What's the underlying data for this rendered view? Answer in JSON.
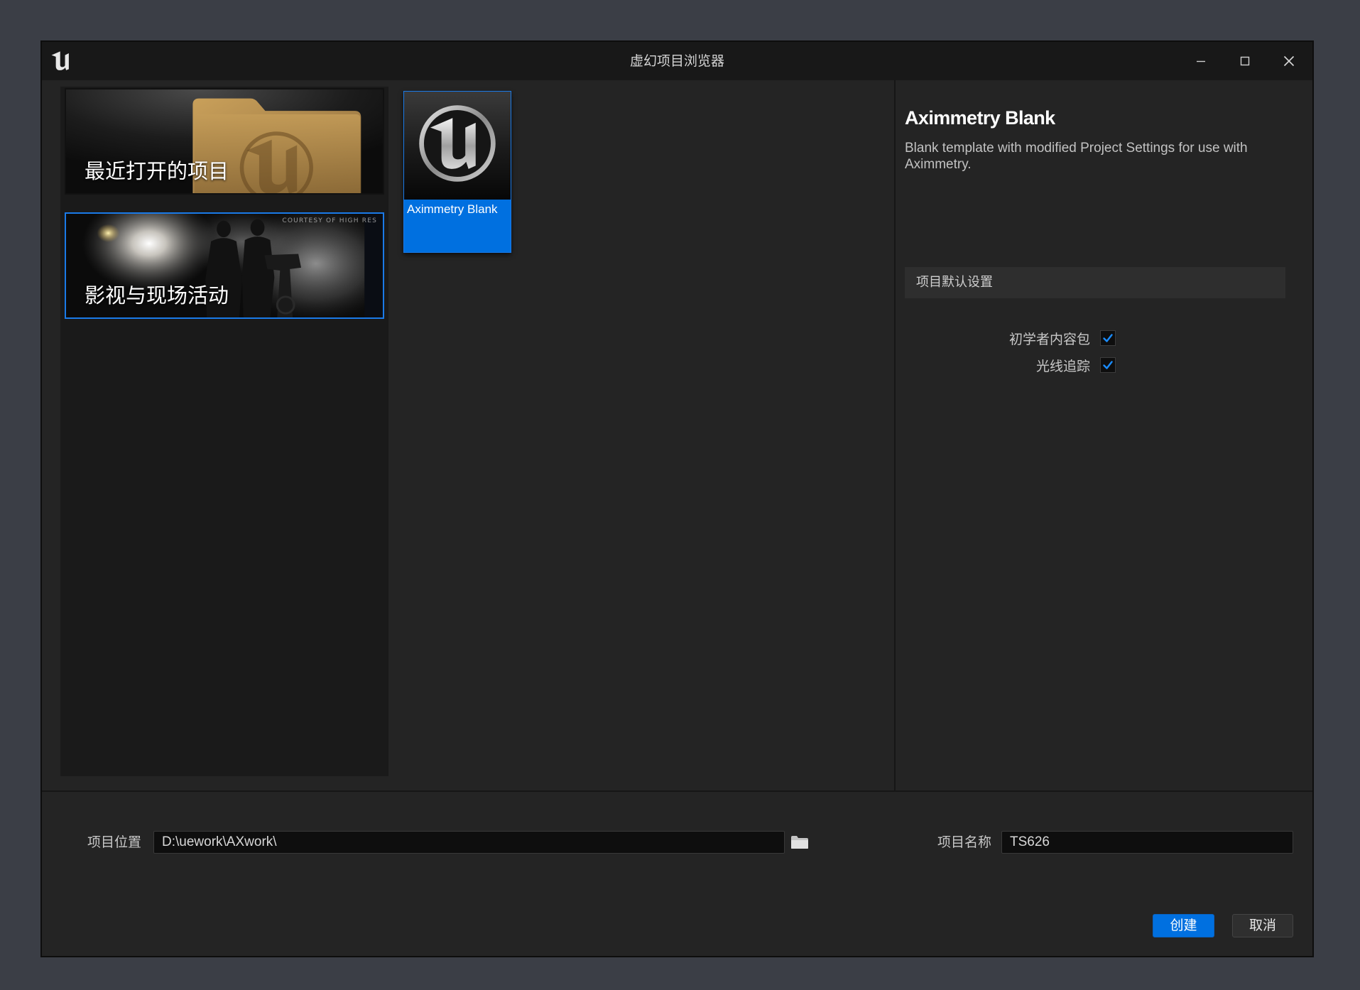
{
  "window": {
    "title": "虚幻项目浏览器",
    "logo_icon": "unreal-logo",
    "controls": [
      "minimize-icon",
      "maximize-icon",
      "close-icon"
    ]
  },
  "categories": [
    {
      "label": "最近打开的项目",
      "thumbnail": "folder-thumbnail",
      "selected": false
    },
    {
      "label": "影视与现场活动",
      "thumbnail": "film-crew-thumbnail",
      "credit": "COURTESY OF HIGH RES",
      "selected": true
    }
  ],
  "templates": [
    {
      "label": "Aximmetry Blank",
      "icon": "unreal-logo",
      "selected": true
    }
  ],
  "details": {
    "title": "Aximmetry Blank",
    "description": "Blank template with modified Project Settings for use with Aximmetry.",
    "section_header": "项目默认设置",
    "options": [
      {
        "label": "初学者内容包",
        "checked": true
      },
      {
        "label": "光线追踪",
        "checked": true
      }
    ]
  },
  "footer": {
    "location_label": "项目位置",
    "location_value": "D:\\uework\\AXwork\\",
    "browse_icon": "folder-icon",
    "name_label": "项目名称",
    "name_value": "TS626",
    "create_label": "创建",
    "cancel_label": "取消"
  },
  "colors": {
    "accent": "#0070e0",
    "background": "#3b3e46",
    "window": "#242424",
    "title_bar": "#181818",
    "panel": "#1a1a1a",
    "check": "#1a8cff"
  }
}
